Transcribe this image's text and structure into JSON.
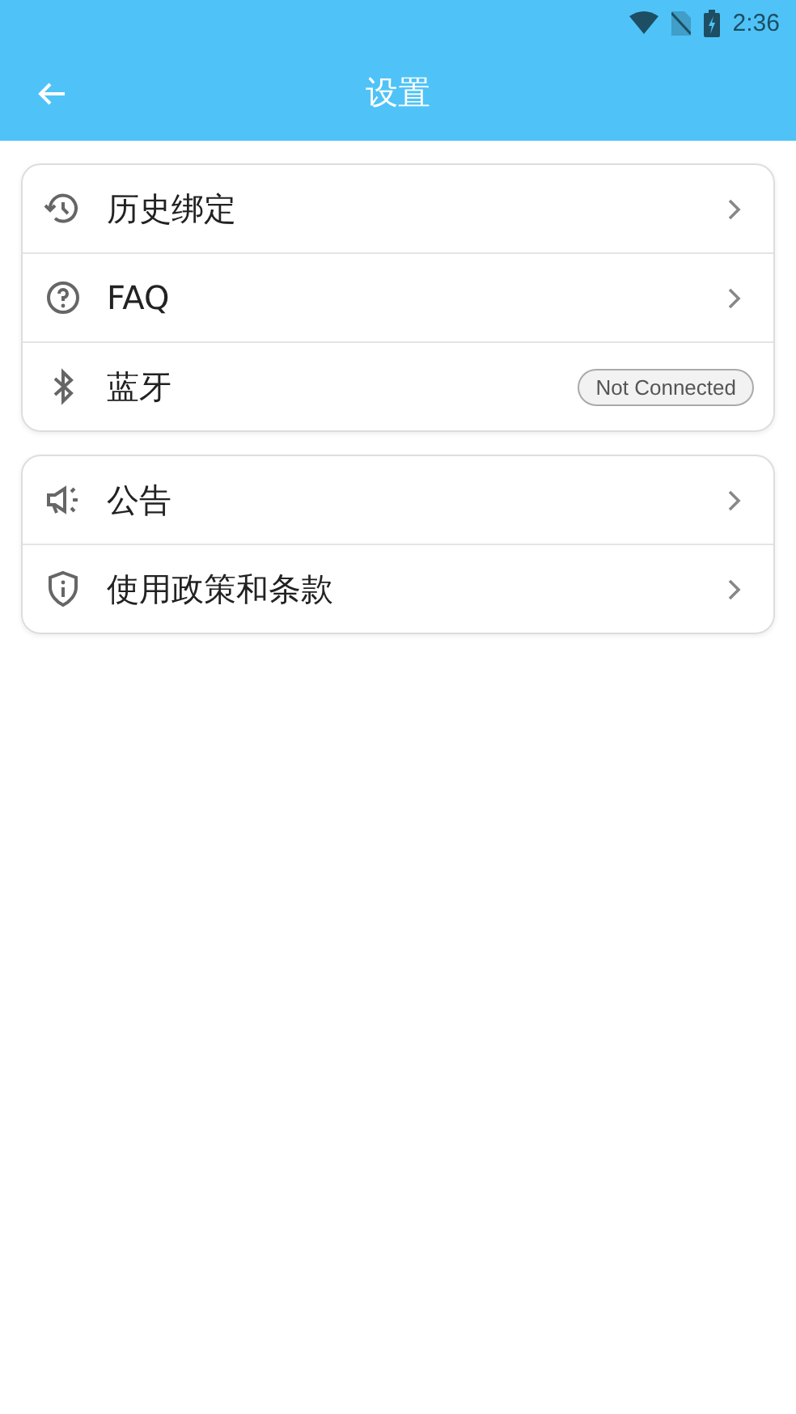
{
  "status_bar": {
    "time": "2:36"
  },
  "app_bar": {
    "title": "设置"
  },
  "groups": [
    {
      "items": [
        {
          "label": "历史绑定"
        },
        {
          "label": "FAQ"
        },
        {
          "label": "蓝牙",
          "badge": "Not Connected"
        }
      ]
    },
    {
      "items": [
        {
          "label": "公告"
        },
        {
          "label": "使用政策和条款"
        }
      ]
    }
  ]
}
